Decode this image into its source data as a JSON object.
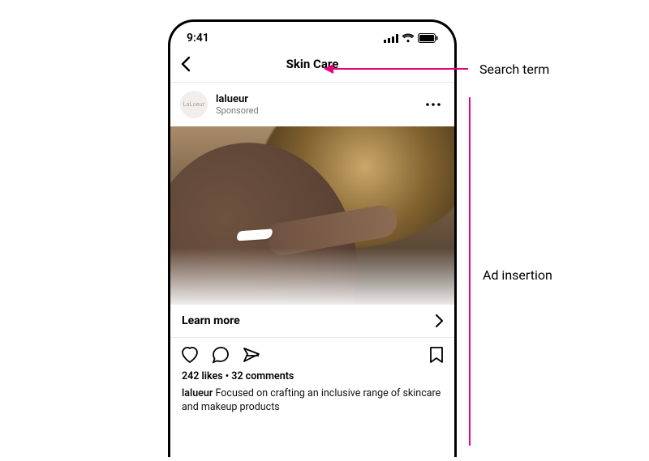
{
  "status": {
    "time": "9:41"
  },
  "nav": {
    "title": "Skin Care"
  },
  "post": {
    "avatar_label": "LaLueur",
    "username": "lalueur",
    "sponsored": "Sponsored",
    "cta_label": "Learn more",
    "likes_comments": "242 likes • 32 comments",
    "caption_user": "lalueur",
    "caption_text": " Focused on crafting an inclusive range of skincare and makeup products"
  },
  "annotations": {
    "search_term": "Search term",
    "ad_insertion": "Ad insertion"
  }
}
